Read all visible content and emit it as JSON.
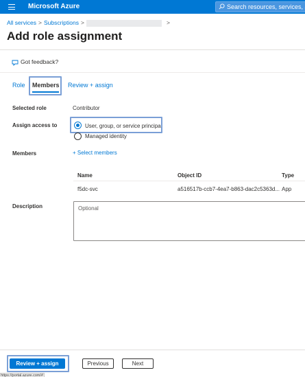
{
  "topbar": {
    "brand": "Microsoft Azure",
    "search_placeholder": "Search resources, services, and docs"
  },
  "breadcrumb": {
    "items": [
      "All services",
      "Subscriptions"
    ]
  },
  "page": {
    "title": "Add role assignment",
    "more_label": "···"
  },
  "feedback": {
    "label": "Got feedback?"
  },
  "tabs": [
    {
      "label": "Role"
    },
    {
      "label": "Members",
      "selected": true
    },
    {
      "label": "Review + assign"
    }
  ],
  "form": {
    "selected_role_label": "Selected role",
    "selected_role_value": "Contributor",
    "assign_access_label": "Assign access to",
    "assign_options": [
      {
        "label": "User, group, or service principal",
        "checked": true
      },
      {
        "label": "Managed identity",
        "checked": false
      }
    ],
    "members_label": "Members",
    "select_members_label": "+ Select members",
    "description_label": "Description",
    "description_placeholder": "Optional"
  },
  "members_table": {
    "columns": [
      "Name",
      "Object ID",
      "Type"
    ],
    "rows": [
      {
        "name": "f5dc-svc",
        "object_id": "a516517b-ccb7-4ea7-b863-dac2c5363d...",
        "type": "App"
      }
    ]
  },
  "footer": {
    "review_assign_label": "Review + assign",
    "previous_label": "Previous",
    "next_label": "Next"
  },
  "status": {
    "url": "https://portal.azure.com/#"
  },
  "colors": {
    "accent": "#0078d4",
    "highlight": "#7a9fd6"
  }
}
